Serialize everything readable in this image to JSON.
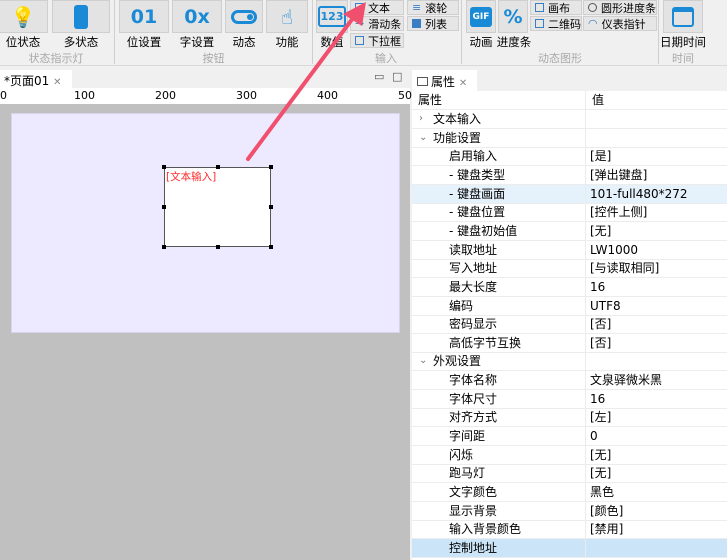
{
  "ribbon": {
    "groups": [
      {
        "label": "状态指示灯",
        "items": [
          "位状态",
          "多状态"
        ]
      },
      {
        "label": "按钮",
        "items": [
          "位设置",
          "字设置",
          "动态",
          "功能"
        ]
      },
      {
        "label": "输入",
        "items": [
          "数值",
          "文本",
          "滑动条",
          "下拉框",
          "滚轮",
          "列表"
        ]
      },
      {
        "label": "动态图形",
        "items": [
          "动画",
          "进度条",
          "画布",
          "二维码",
          "圆形进度条",
          "仪表指针"
        ]
      },
      {
        "label": "时间",
        "items": [
          "日期时间"
        ]
      }
    ],
    "icons": {
      "bit_setting": "01",
      "word_setting": "0x",
      "numeric": "123",
      "gif": "GIF",
      "progress": "%"
    }
  },
  "editor": {
    "tab_label": "*页面01",
    "ruler_ticks": [
      "0",
      "100",
      "200",
      "300",
      "400",
      "50"
    ],
    "widget_label": "[文本输入]"
  },
  "properties": {
    "tab_label": "属性",
    "header": {
      "name": "属性",
      "value": "值"
    },
    "rows": [
      {
        "name": "文本输入",
        "value": "",
        "type": "cat-collapsed"
      },
      {
        "name": "功能设置",
        "value": "",
        "type": "cat"
      },
      {
        "name": "启用输入",
        "value": "[是]"
      },
      {
        "name": "- 键盘类型",
        "value": "[弹出键盘]"
      },
      {
        "name": "- 键盘画面",
        "value": "101-full480*272",
        "state": "hover"
      },
      {
        "name": "- 键盘位置",
        "value": "[控件上侧]"
      },
      {
        "name": "- 键盘初始值",
        "value": "[无]"
      },
      {
        "name": "读取地址",
        "value": "LW1000"
      },
      {
        "name": "写入地址",
        "value": "[与读取相同]"
      },
      {
        "name": "最大长度",
        "value": "16"
      },
      {
        "name": "编码",
        "value": "UTF8"
      },
      {
        "name": "密码显示",
        "value": "[否]"
      },
      {
        "name": "高低字节互换",
        "value": "[否]"
      },
      {
        "name": "外观设置",
        "value": "",
        "type": "cat"
      },
      {
        "name": "字体名称",
        "value": "文泉驿微米黑"
      },
      {
        "name": "字体尺寸",
        "value": "16"
      },
      {
        "name": "对齐方式",
        "value": "[左]"
      },
      {
        "name": "字间距",
        "value": "0"
      },
      {
        "name": "闪烁",
        "value": "[无]"
      },
      {
        "name": "跑马灯",
        "value": "[无]"
      },
      {
        "name": "文字颜色",
        "value": "黑色"
      },
      {
        "name": "显示背景",
        "value": "[颜色]"
      },
      {
        "name": "输入背景颜色",
        "value": "[禁用]"
      },
      {
        "name": "控制地址",
        "value": "",
        "state": "selected"
      }
    ]
  },
  "colors": {
    "accent": "#1a8ad6",
    "arrow": "#f0506e",
    "widget_text": "#ff2a2a",
    "hover": "#e5f1fb",
    "selected": "#cce4f7"
  }
}
